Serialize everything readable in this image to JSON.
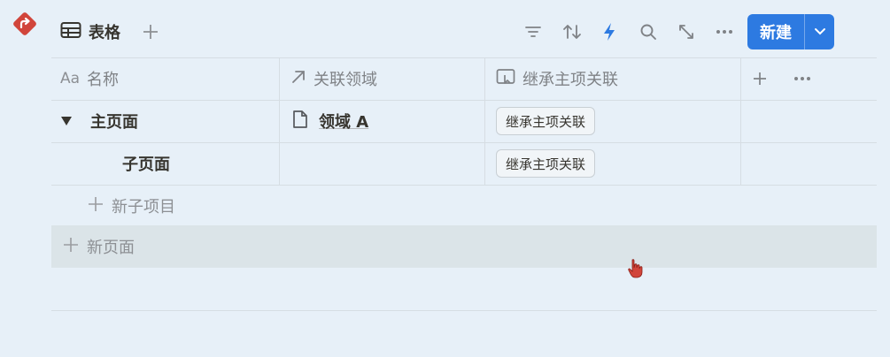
{
  "toolbar": {
    "view_name": "表格",
    "new_label": "新建",
    "icons": [
      "table-icon",
      "plus-icon",
      "filter-icon",
      "sort-icon",
      "lightning-icon",
      "search-icon",
      "expand-icon",
      "more-icon",
      "chevron-down-icon"
    ]
  },
  "table": {
    "columns": [
      {
        "icon_text": "Aa",
        "label": "名称"
      },
      {
        "label": "关联领域"
      },
      {
        "label": "继承主项关联"
      }
    ],
    "rows": [
      {
        "name": "主页面",
        "relation": "领域 A",
        "inherited": "继承主项关联"
      },
      {
        "name": "子页面",
        "relation": "",
        "inherited": "继承主项关联"
      }
    ],
    "new_sub_item": "新子项目",
    "new_page": "新页面"
  },
  "colors": {
    "background": "#e7f0f8",
    "accent": "#2d7ae1",
    "logo": "#d1453b",
    "lightning": "#2d7ae1"
  }
}
